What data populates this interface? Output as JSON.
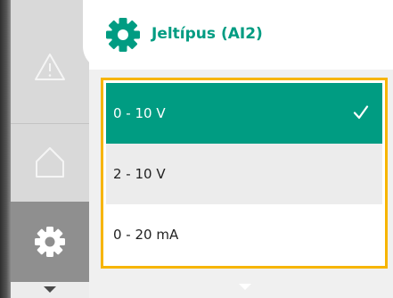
{
  "header": {
    "title": "Jeltípus (AI2)",
    "icon": "gear-icon"
  },
  "nav": {
    "items": [
      {
        "name": "warning",
        "icon": "warning-icon"
      },
      {
        "name": "home",
        "icon": "home-icon"
      },
      {
        "name": "settings",
        "icon": "gear-icon",
        "active": true
      }
    ],
    "scroll_icon": "chevron-down-icon"
  },
  "options": [
    {
      "label": "0 - 10 V",
      "selected": true
    },
    {
      "label": "2 - 10 V",
      "selected": false
    },
    {
      "label": "0 - 20 mA",
      "selected": false
    }
  ],
  "colors": {
    "accent": "#009c82",
    "focus_border": "#f7b500",
    "rail": "#d9d9d9",
    "rail_active": "#8f8f8f"
  }
}
